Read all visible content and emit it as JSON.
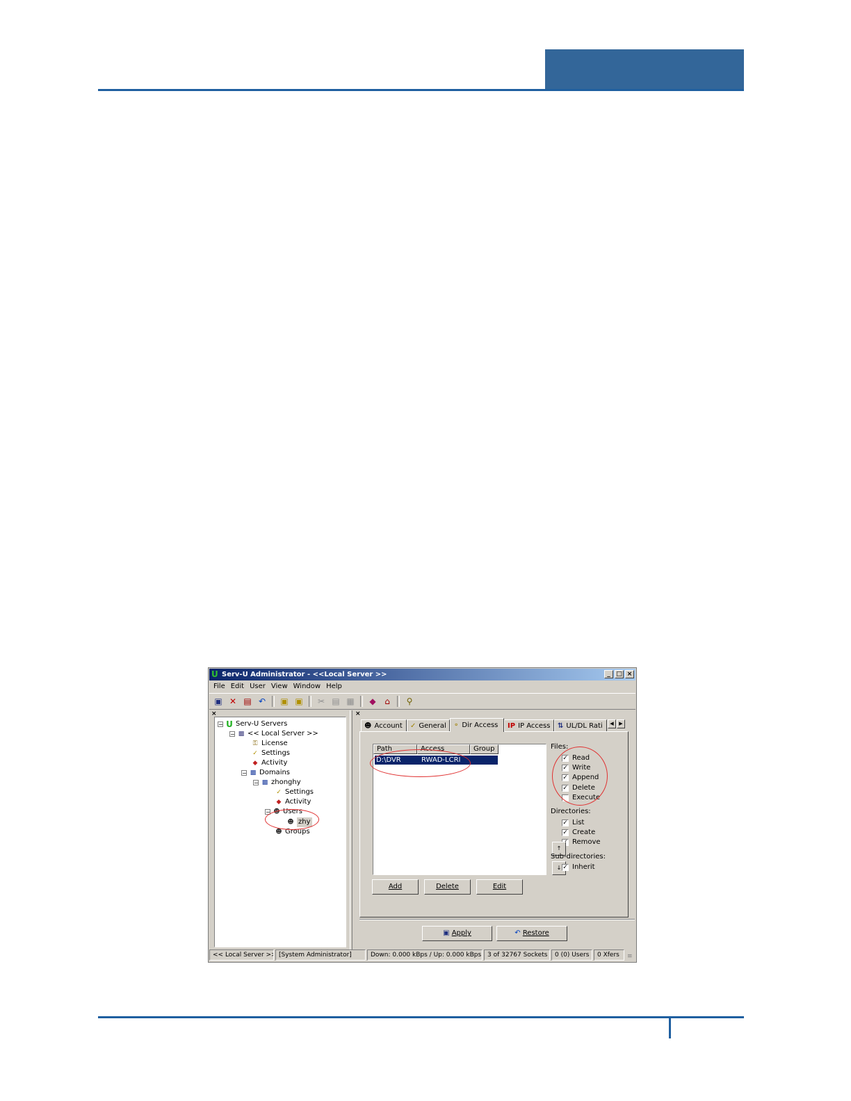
{
  "colors": {
    "accent": "#336699",
    "rule": "#1f5fa0",
    "annotation": "#e03030",
    "selection": "#0a246a"
  },
  "window": {
    "title": "Serv-U Administrator - <<Local Server >>",
    "controls": [
      "_",
      "□",
      "×"
    ]
  },
  "menu": [
    "File",
    "Edit",
    "User",
    "View",
    "Window",
    "Help"
  ],
  "toolbar": [
    "save-icon",
    "delete-icon",
    "copy-icon",
    "undo-icon",
    "folder-icon",
    "folder-refresh-icon",
    "cut-icon",
    "copy2-icon",
    "paste-icon",
    "book-icon",
    "server-icon",
    "help-icon"
  ],
  "left_pane": {
    "close": "×",
    "tree": [
      {
        "label": "Serv-U Servers",
        "icon": "serv-u-icon",
        "expander": "−"
      },
      {
        "label": "<< Local Server >>",
        "icon": "computer-icon",
        "expander": "−"
      },
      {
        "label": "License",
        "icon": "key-icon"
      },
      {
        "label": "Settings",
        "icon": "settings-icon"
      },
      {
        "label": "Activity",
        "icon": "activity-icon"
      },
      {
        "label": "Domains",
        "icon": "domains-icon",
        "expander": "−"
      },
      {
        "label": "zhonghy",
        "icon": "computer-icon",
        "expander": "−"
      },
      {
        "label": "Settings",
        "icon": "settings-icon"
      },
      {
        "label": "Activity",
        "icon": "activity-icon"
      },
      {
        "label": "Users",
        "icon": "users-icon",
        "expander": "−"
      },
      {
        "label": "zhy",
        "icon": "user-icon"
      },
      {
        "label": "Groups",
        "icon": "groups-icon"
      }
    ]
  },
  "right_pane": {
    "close": "×",
    "tabs": [
      "Account",
      "General",
      "Dir Access",
      "IP Access",
      "UL/DL Rati"
    ],
    "active_tab": "Dir Access",
    "list": {
      "columns": [
        "Path",
        "Access",
        "Group"
      ],
      "rows": [
        {
          "path": "D:\\DVR",
          "access": "RWAD-LCRI",
          "group": ""
        }
      ]
    },
    "buttons": {
      "add": "Add",
      "delete": "Delete",
      "edit": "Edit"
    },
    "files": {
      "label": "Files:",
      "items": [
        {
          "label": "Read",
          "checked": true
        },
        {
          "label": "Write",
          "checked": true
        },
        {
          "label": "Append",
          "checked": true
        },
        {
          "label": "Delete",
          "checked": true
        },
        {
          "label": "Execute",
          "checked": false
        }
      ]
    },
    "directories": {
      "label": "Directories:",
      "items": [
        {
          "label": "List",
          "checked": true
        },
        {
          "label": "Create",
          "checked": true
        },
        {
          "label": "Remove",
          "checked": true
        }
      ]
    },
    "subdirectories": {
      "label": "Sub-directories:",
      "items": [
        {
          "label": "Inherit",
          "checked": true
        }
      ]
    },
    "apply": "Apply",
    "restore": "Restore"
  },
  "status": [
    "<< Local Server >>",
    "[System Administrator]",
    "Down: 0.000 kBps / Up: 0.000 kBps",
    "3 of 32767 Sockets",
    "0 (0) Users",
    "0 Xfers"
  ]
}
